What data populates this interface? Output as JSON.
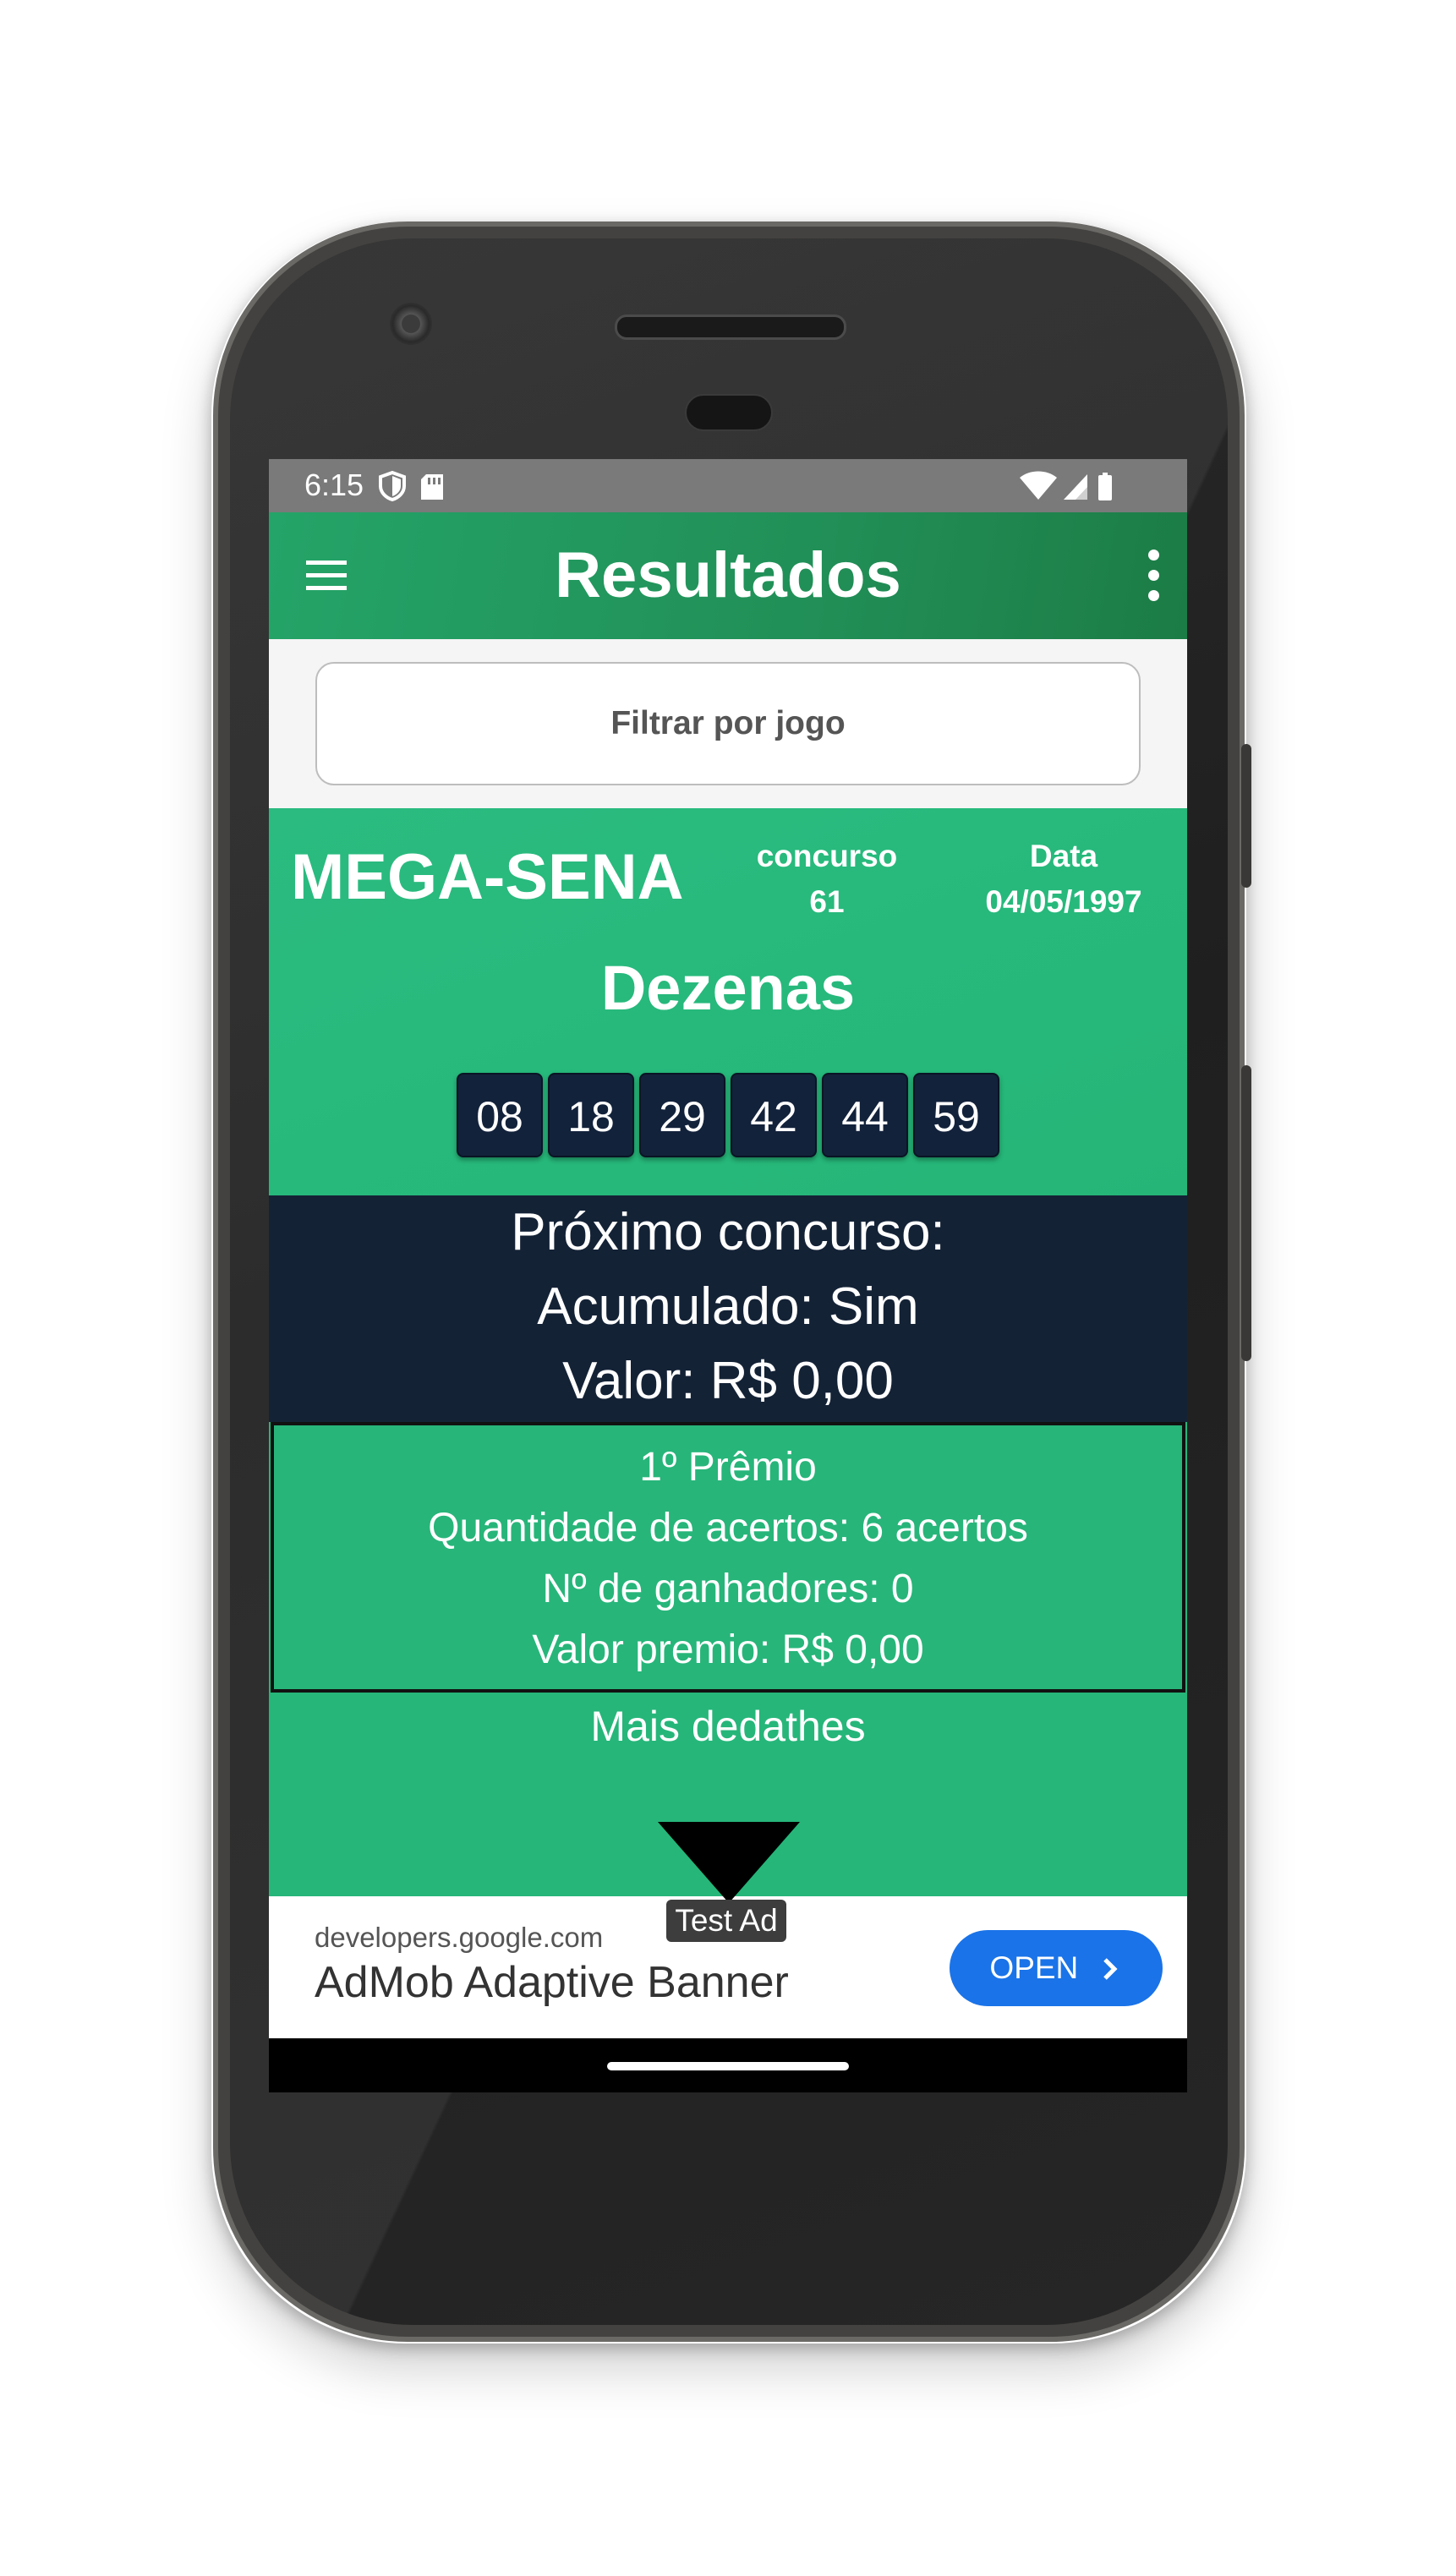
{
  "status_bar": {
    "time": "6:15"
  },
  "app_bar": {
    "title": "Resultados"
  },
  "filter": {
    "label": "Filtrar por jogo"
  },
  "result": {
    "game": "MEGA-SENA",
    "contest_label": "concurso",
    "contest_number": "61",
    "date_label": "Data",
    "date": "04/05/1997",
    "dezenas_title": "Dezenas",
    "numbers": [
      "08",
      "18",
      "29",
      "42",
      "44",
      "59"
    ]
  },
  "next_contest": {
    "title": "Próximo concurso:",
    "accumulated": "Acumulado: Sim",
    "value": "Valor: R$ 0,00"
  },
  "prize": {
    "title": "1º Prêmio",
    "hits": "Quantidade de acertos: 6 acertos",
    "winners": "Nº de ganhadores: 0",
    "value": "Valor premio: R$ 0,00"
  },
  "more_details": "Mais dedathes",
  "ad": {
    "test_label": "Test Ad",
    "url": "developers.google.com",
    "title": "AdMob Adaptive Banner",
    "button": "OPEN"
  },
  "colors": {
    "app_bar": "#218f57",
    "card_green": "#26b67a",
    "dark_navy": "#142236",
    "ad_button": "#1a73e8"
  }
}
